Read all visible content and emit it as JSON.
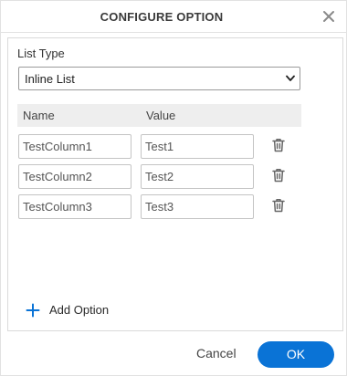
{
  "dialog": {
    "title": "CONFIGURE OPTION",
    "close_icon": "close-icon"
  },
  "list_type": {
    "label": "List Type",
    "selected": "Inline List",
    "chevron_icon": "chevron-down-icon"
  },
  "table": {
    "columns": [
      "Name",
      "Value"
    ],
    "rows": [
      {
        "name": "TestColumn1",
        "value": "Test1",
        "delete_icon": "trash-icon"
      },
      {
        "name": "TestColumn2",
        "value": "Test2",
        "delete_icon": "trash-icon"
      },
      {
        "name": "TestColumn3",
        "value": "Test3",
        "delete_icon": "trash-icon"
      }
    ]
  },
  "add_option": {
    "label": "Add Option",
    "icon": "plus-icon"
  },
  "footer": {
    "cancel_label": "Cancel",
    "ok_label": "OK"
  },
  "colors": {
    "primary": "#0a73d6",
    "header_bg": "#eeeeee",
    "icon_gray": "#666666"
  }
}
